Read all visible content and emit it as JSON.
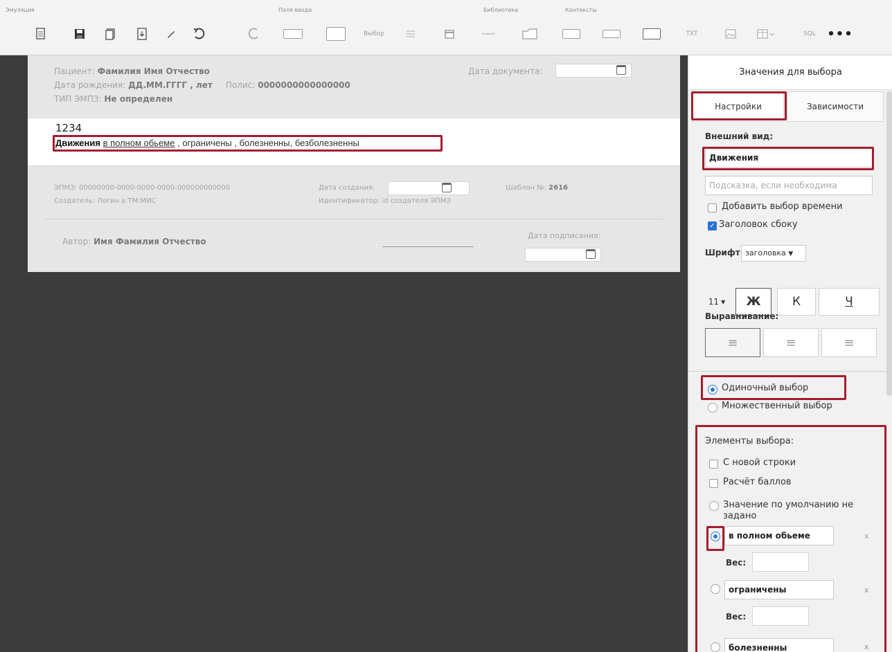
{
  "toolbar": {
    "groups": [
      "Эмуляция",
      "Поля ввода",
      "Библиотека",
      "Контексты"
    ],
    "select_label": "Выбор",
    "txt_label": "TXT",
    "sql_label": "SQL",
    "more_label": "•••"
  },
  "document": {
    "patient_label": "Пациент:",
    "patient_name": "Фамилия Имя Отчество",
    "birth_label": "Дата рождения:",
    "birth_value": "ДД.ММ.ГГГГ , лет",
    "policy_label": "Полис:",
    "policy_value": "0000000000000000",
    "type_label": "ТИП ЭМПЗ:",
    "type_value": "Не определен",
    "doc_date_label": "Дата документа:",
    "code": "1234",
    "movements_title": "Движения",
    "options": [
      "в полном обьеме",
      "ограничены",
      "болезненны",
      "безболезненны"
    ],
    "emr_label": "ЭПМЗ:",
    "emr_value": "00000000-0000-0000-0000-000000000000",
    "creator_label": "Создатель:",
    "creator_value": "Логин в ТМ:МИС",
    "created_date_label": "Дата создания:",
    "creator_id_label": "Идентификатор:",
    "creator_id_value": "id создателя ЭПМЗ",
    "template_label": "Шаблон №:",
    "template_value": "2616",
    "author_label": "Автор:",
    "author_name": "Имя Фамилия Отчество",
    "sign_date_label": "Дата подписания:"
  },
  "panel": {
    "header": "Значения для выбора",
    "tabs": [
      "Настройки",
      "Зависимости"
    ],
    "appearance_label": "Внешний вид:",
    "appearance_value": "Движения",
    "hint_placeholder": "Подсказка, если необходима",
    "add_time_label": "Добавить выбор времени",
    "side_title_label": "Заголовок сбоку",
    "font_label": "Шрифт:",
    "font_value": "заголовка",
    "size_value": "11",
    "bold": "Ж",
    "italic": "К",
    "underline": "Ч",
    "align_label": "Выравнивание:",
    "single_choice": "Одиночный выбор",
    "multi_choice": "Множественный выбор",
    "elements_label": "Элементы выбора:",
    "new_line_label": "С новой строки",
    "score_label": "Расчёт баллов",
    "default_value_label": "Значение по умолчанию не задано",
    "items": [
      {
        "value": "в полном обьеме",
        "selected": true
      },
      {
        "value": "ограничены",
        "selected": false
      },
      {
        "value": "болезненны",
        "selected": false
      }
    ],
    "weight_label": "Вес:",
    "remove_label": "x"
  },
  "colors": {
    "highlight": "#a51d2d",
    "accent": "#2a7ae2",
    "workspace": "#3c3c3c"
  }
}
